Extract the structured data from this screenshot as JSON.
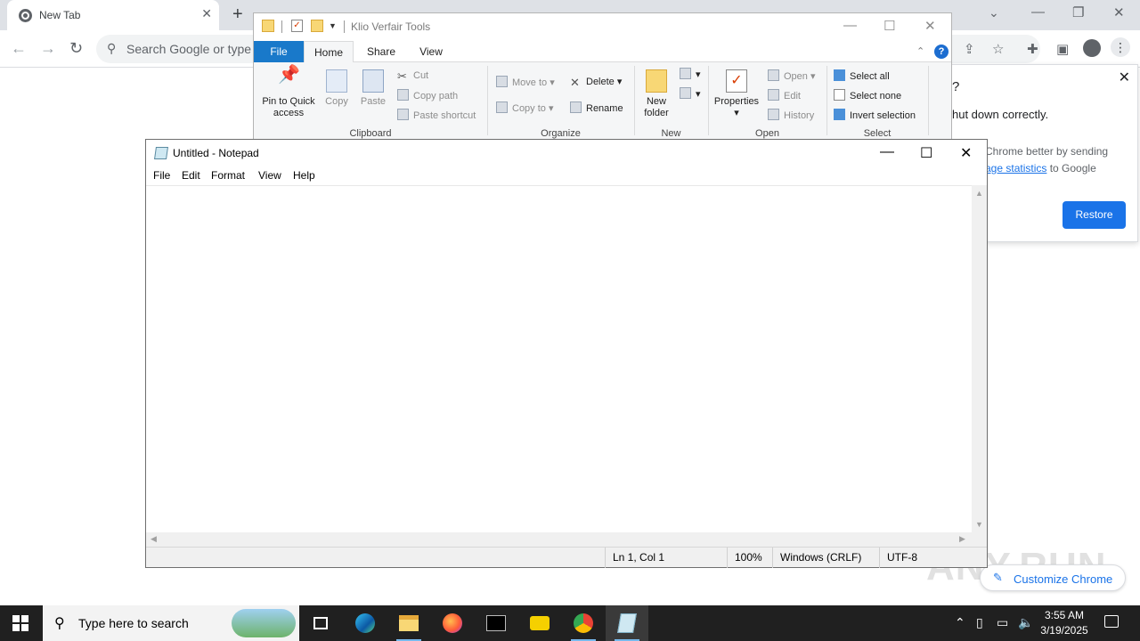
{
  "chrome": {
    "tab_title": "New Tab",
    "omnibox_placeholder": "Search Google or type a URL",
    "restore_bubble": {
      "title_tail": "?",
      "message_tail": "hut down correctly.",
      "help_line1": "Chrome better by sending",
      "help_link": "age statistics",
      "help_line2_tail": " to Google",
      "restore_label": "Restore"
    },
    "customize_label": "Customize Chrome",
    "watermark": "ANY.RUN"
  },
  "explorer": {
    "title": "Klio Verfair Tools",
    "tabs": [
      "File",
      "Home",
      "Share",
      "View"
    ],
    "help_label": "?",
    "clipboard": {
      "pin_label": "Pin to Quick access",
      "copy_label": "Copy",
      "paste_label": "Paste",
      "cut_label": "Cut",
      "copy_path_label": "Copy path",
      "paste_shortcut_label": "Paste shortcut",
      "group_label": "Clipboard"
    },
    "organize": {
      "move_to_label": "Move to",
      "copy_to_label": "Copy to",
      "delete_label": "Delete",
      "rename_label": "Rename",
      "group_label": "Organize"
    },
    "new": {
      "new_folder_label": "New folder",
      "group_label": "New"
    },
    "open": {
      "properties_label": "Properties",
      "open_label": "Open",
      "edit_label": "Edit",
      "history_label": "History",
      "group_label": "Open"
    },
    "select": {
      "select_all_label": "Select all",
      "select_none_label": "Select none",
      "invert_label": "Invert selection",
      "group_label": "Select"
    }
  },
  "notepad": {
    "title": "Untitled - Notepad",
    "menu": [
      "File",
      "Edit",
      "Format",
      "View",
      "Help"
    ],
    "status": {
      "position": "Ln 1, Col 1",
      "zoom": "100%",
      "line_ending": "Windows (CRLF)",
      "encoding": "UTF-8"
    }
  },
  "taskbar": {
    "search_placeholder": "Type here to search",
    "apps": [
      "task-view",
      "edge",
      "file-explorer",
      "firefox",
      "terminal",
      "pdf-app",
      "chrome",
      "notepad"
    ],
    "time": "3:55 AM",
    "date": "3/19/2025"
  },
  "colors": {
    "chrome_blue": "#1a73e8",
    "ribbon_file_blue": "#1979ca",
    "taskbar_bg": "#202020"
  }
}
